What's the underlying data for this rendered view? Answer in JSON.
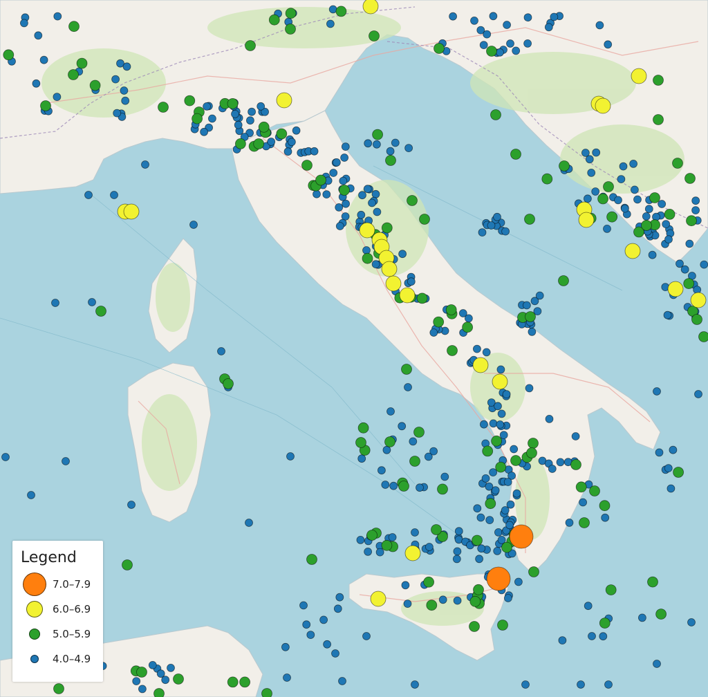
{
  "map": {
    "colors": {
      "sea": "#aad3df",
      "land": "#f2efe9",
      "forest": "#cfe5b6",
      "road": "#e9a7a0",
      "border": "#9e8ab8"
    },
    "categories": [
      {
        "key": "m7",
        "label": "7.0–7.9",
        "color": "#ff7f0e"
      },
      {
        "key": "m6",
        "label": "6.0–6.9",
        "color": "#f2f231"
      },
      {
        "key": "m5",
        "label": "5.0–5.9",
        "color": "#2ca02c"
      },
      {
        "key": "m4",
        "label": "4.0–4.9",
        "color": "#1f77b4"
      }
    ]
  },
  "legend": {
    "title": "Legend",
    "items": [
      {
        "label": "7.0–7.9",
        "color": "#ff7f0e"
      },
      {
        "label": "6.0–6.9",
        "color": "#f2f231"
      },
      {
        "label": "5.0–5.9",
        "color": "#2ca02c"
      },
      {
        "label": "4.0–4.9",
        "color": "#1f77b4"
      }
    ]
  }
}
